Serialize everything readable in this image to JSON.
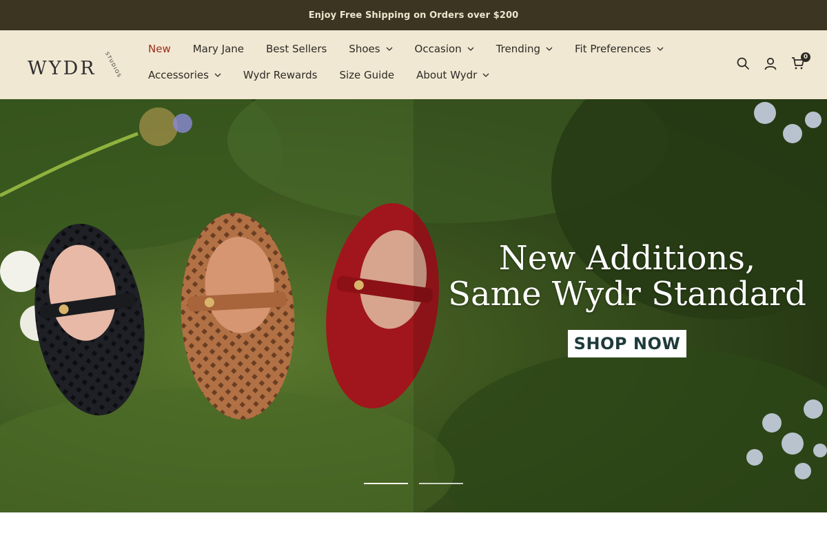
{
  "announcement": {
    "text": "Enjoy Free Shipping on Orders over $200"
  },
  "brand": {
    "name": "WYDR",
    "sub": "STUDIOS"
  },
  "nav": {
    "row1": [
      {
        "label": "New",
        "dropdown": false,
        "active": true
      },
      {
        "label": "Mary Jane",
        "dropdown": false
      },
      {
        "label": "Best Sellers",
        "dropdown": false
      },
      {
        "label": "Shoes",
        "dropdown": true
      },
      {
        "label": "Occasion",
        "dropdown": true
      },
      {
        "label": "Trending",
        "dropdown": true
      },
      {
        "label": "Fit Preferences",
        "dropdown": true
      }
    ],
    "row2": [
      {
        "label": "Accessories",
        "dropdown": true
      },
      {
        "label": "Wydr Rewards",
        "dropdown": false
      },
      {
        "label": "Size Guide",
        "dropdown": false
      },
      {
        "label": "About Wydr",
        "dropdown": true
      }
    ]
  },
  "icons": {
    "search": "search-icon",
    "account": "user-icon",
    "cart": "cart-icon"
  },
  "cart": {
    "count": "0"
  },
  "hero": {
    "title_line1": "New Additions,",
    "title_line2": "Same Wydr Standard",
    "button": "SHOP NOW",
    "slides": 2,
    "active_slide": 1
  },
  "colors": {
    "announcement_bg": "#3b3521",
    "header_bg": "#f1e8d3",
    "active_nav": "#9a2a17"
  }
}
